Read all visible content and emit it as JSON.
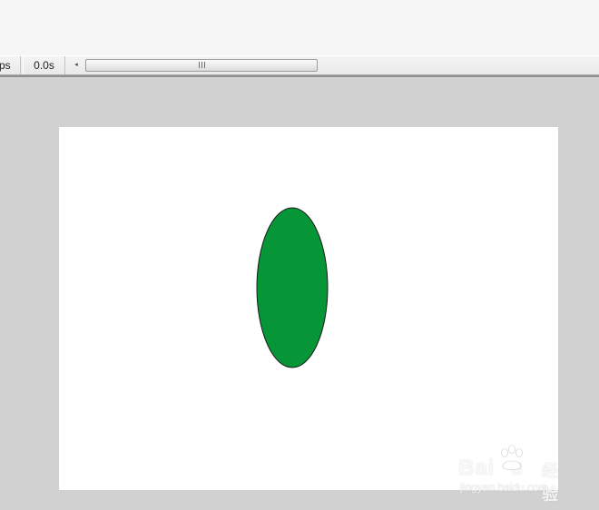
{
  "status_bar": {
    "fps_text": "ps",
    "time_text": "0.0s",
    "scroll_left_arrow": "◂"
  },
  "stage": {
    "background_color": "#ffffff",
    "ellipse_fill": "#069638",
    "ellipse_stroke": "#1a1a1a"
  },
  "watermark": {
    "logo_text": "Bai",
    "logo_suffix": "u",
    "brand_text": "经验",
    "url_text": "jingyan.baidu.com"
  },
  "colors": {
    "workspace": "#d1d1d1",
    "panel": "#f6f6f6"
  }
}
